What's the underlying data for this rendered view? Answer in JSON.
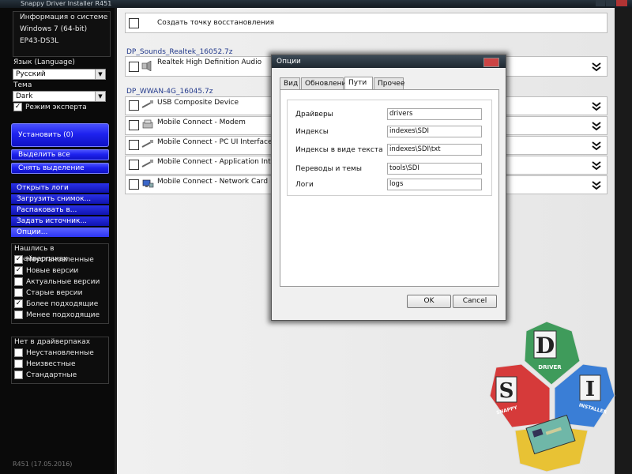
{
  "title": "Snappy Driver Installer R451",
  "sidebar": {
    "sysinfo": [
      "Информация о системе",
      "Windows 7 (64-bit)",
      "EP43-DS3L"
    ],
    "language_label": "Язык (Language)",
    "language_value": "Русский",
    "theme_label": "Тема",
    "theme_value": "Dark",
    "expert_mode": "Режим эксперта",
    "install": "Установить (0)",
    "select_all": "Выделить все",
    "deselect": "Снять выделение",
    "menu": [
      "Открыть логи",
      "Загрузить снимок...",
      "Распаковать в...",
      "Задать источник...",
      "Опции..."
    ],
    "found_title": "Нашлись в драйверпаках",
    "found_filters": [
      {
        "label": "Неустановленные",
        "checked": true
      },
      {
        "label": "Новые версии",
        "checked": true
      },
      {
        "label": "Актуальные версии",
        "checked": false
      },
      {
        "label": "Старые версии",
        "checked": false
      },
      {
        "label": "Более подходящие",
        "checked": true
      },
      {
        "label": "Менее подходящие",
        "checked": false
      }
    ],
    "notfound_title": "Нет в драйверпаках",
    "notfound_filters": [
      {
        "label": "Неустановленные",
        "checked": false
      },
      {
        "label": "Неизвестные",
        "checked": false
      },
      {
        "label": "Стандартные",
        "checked": false
      }
    ],
    "version": "R451 (17.05.2016)"
  },
  "main": {
    "restore_point": "Создать точку восстановления",
    "packs": [
      {
        "name": "DP_Sounds_Realtek_16052.7z",
        "drivers": [
          "Realtek High Definition Audio"
        ]
      },
      {
        "name": "DP_WWAN-4G_16045.7z",
        "drivers": [
          "USB Composite Device",
          "Mobile Connect - Modem",
          "Mobile Connect - PC UI Interface",
          "Mobile Connect - Application Interface",
          "Mobile Connect - Network Card"
        ]
      }
    ]
  },
  "dialog": {
    "title": "Опции",
    "tabs": [
      "Вид",
      "Обновления",
      "Пути",
      "Прочее"
    ],
    "active_tab": "Пути",
    "fields": [
      {
        "label": "Драйверы",
        "value": "drivers"
      },
      {
        "label": "Индексы",
        "value": "indexes\\SDI"
      },
      {
        "label": "Индексы в виде текста",
        "value": "indexes\\SDI\\txt"
      },
      {
        "label": "Переводы и темы",
        "value": "tools\\SDI"
      },
      {
        "label": "Логи",
        "value": "logs"
      }
    ],
    "ok": "OK",
    "cancel": "Cancel"
  },
  "logo": {
    "letters": [
      "D",
      "S",
      "I"
    ],
    "words": [
      "DRIVER",
      "SNAPPY",
      "INSTALLER"
    ],
    "colors": [
      "#3f9b5b",
      "#d63a3a",
      "#3a7ed6",
      "#e8c234"
    ]
  }
}
